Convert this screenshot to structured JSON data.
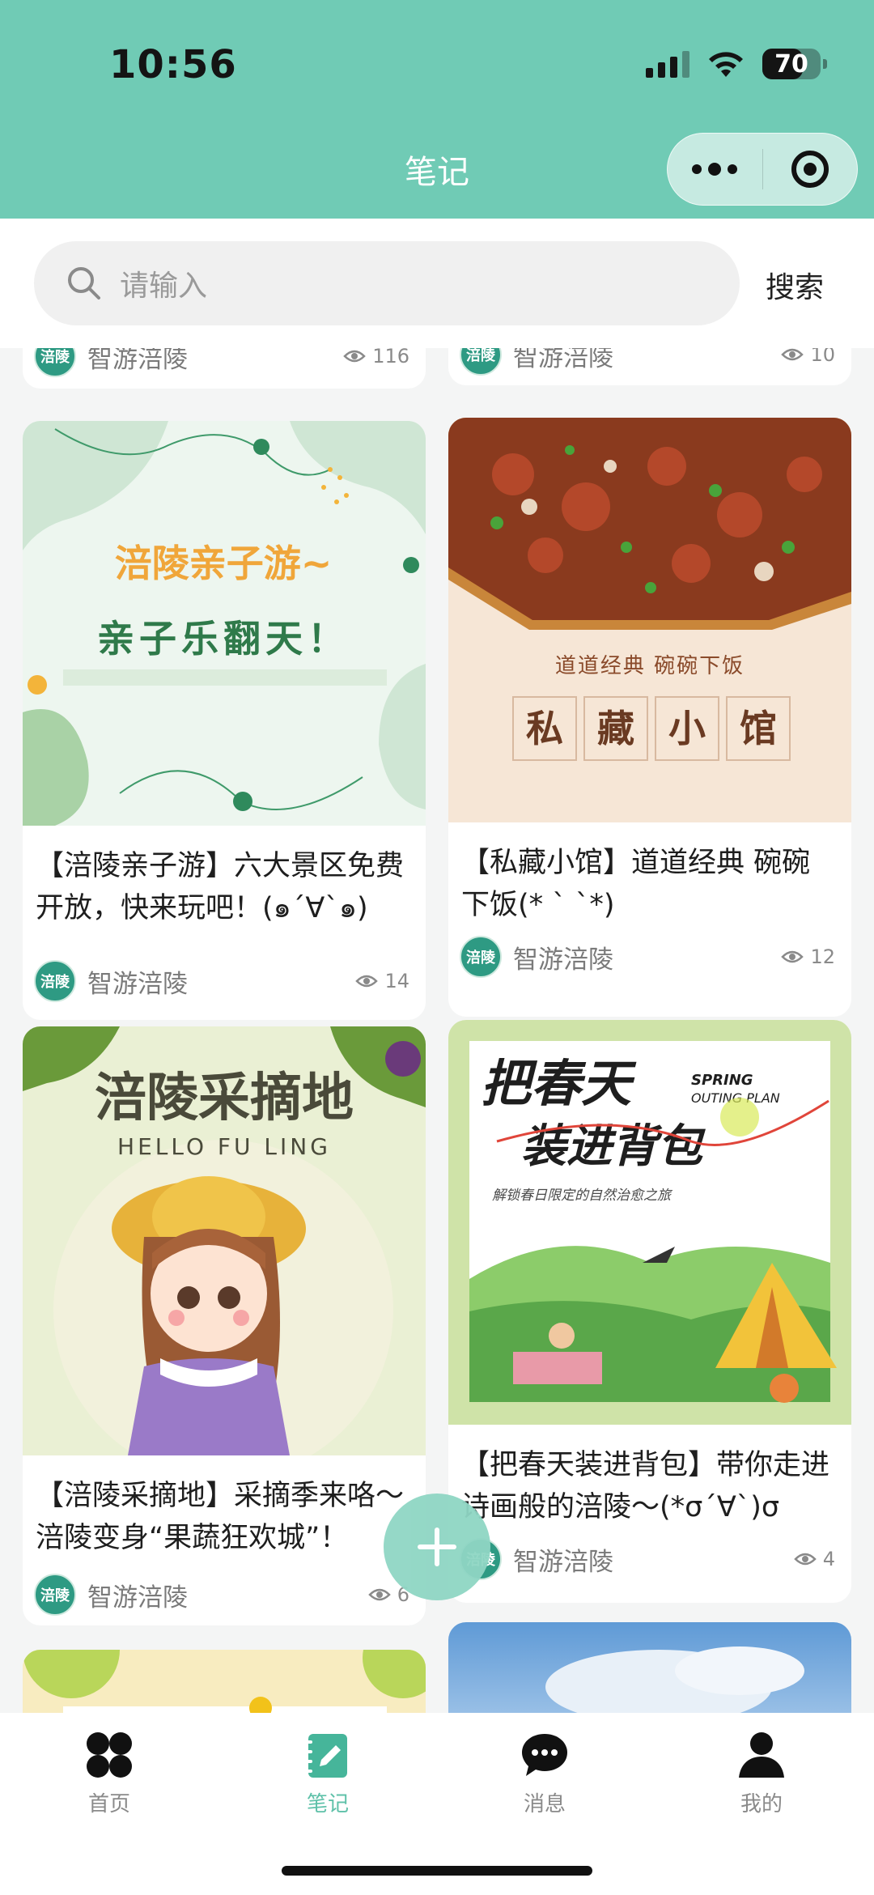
{
  "status_bar": {
    "time": "10:56",
    "battery": "70",
    "battery_level": 0.7
  },
  "header": {
    "title": "笔记"
  },
  "search": {
    "placeholder": "请输入",
    "button": "搜索"
  },
  "feed": {
    "partial_top": [
      {
        "author": "智游涪陵",
        "views": "116"
      },
      {
        "author": "智游涪陵",
        "views": "10"
      }
    ],
    "cards": [
      {
        "image_text": [
          "涪陵亲子游~",
          "亲子乐翻天！"
        ],
        "title": "【涪陵亲子游】六大景区免费开放，快来玩吧！(๑´∀`๑)",
        "author": "智游涪陵",
        "views": "14"
      },
      {
        "image_text": [
          "道道经典 碗碗下饭",
          "私",
          "藏",
          "小",
          "馆"
        ],
        "title": "【私藏小馆】道道经典 碗碗下饭(* ` `*)",
        "author": "智游涪陵",
        "views": "12"
      },
      {
        "image_text": [
          "涪陵采摘地",
          "HELLO FU LING"
        ],
        "title": "【涪陵采摘地】采摘季来咯～涪陵变身“果蔬狂欢城”！",
        "author": "智游涪陵",
        "views": "6"
      },
      {
        "image_text": [
          "把春天",
          "装进背包",
          "SPRING",
          "OUTING PLAN",
          "解锁春日限定的自然治愈之旅"
        ],
        "title": "【把春天装进背包】带你走进诗画般的涪陵～(*σ´∀`)σ",
        "author": "智游涪陵",
        "views": "4"
      }
    ],
    "avatar_text": "涪陵"
  },
  "tabbar": {
    "items": [
      {
        "label": "首页",
        "icon": "grid-icon"
      },
      {
        "label": "笔记",
        "icon": "note-edit-icon",
        "active": true
      },
      {
        "label": "消息",
        "icon": "chat-bubble-icon"
      },
      {
        "label": "我的",
        "icon": "person-icon"
      }
    ]
  },
  "colors": {
    "header_bg": "#70cbb5",
    "accent": "#5fc1a9",
    "fab": "#8fd6c4"
  }
}
